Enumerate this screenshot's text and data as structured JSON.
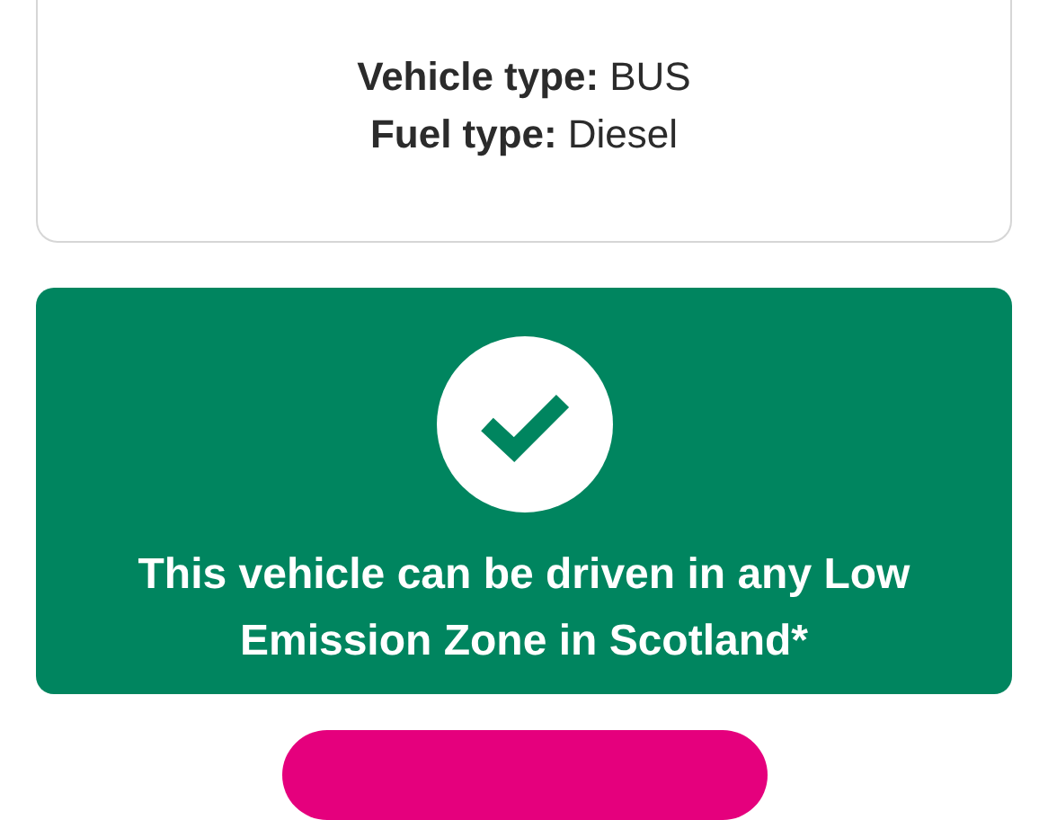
{
  "vehicle_details": [
    {
      "label": "Vehicle type:",
      "value": "BUS"
    },
    {
      "label": "Fuel type:",
      "value": "Diesel"
    }
  ],
  "result": {
    "kind": "compliant",
    "message": "This vehicle can be driven in any Low Emission Zone in Scotland*"
  },
  "next_button": {
    "kind": "primary"
  }
}
